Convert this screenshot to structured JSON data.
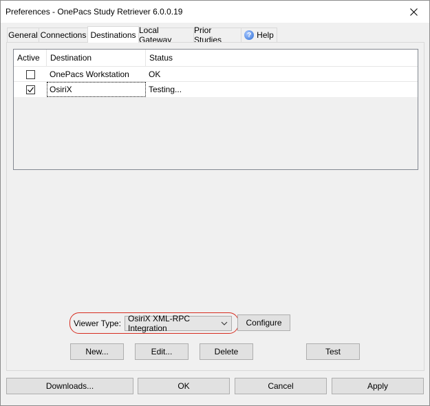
{
  "window": {
    "title": "Preferences - OnePacs Study Retriever 6.0.0.19",
    "close_symbol": "close-icon"
  },
  "tabs": [
    {
      "label": "General",
      "active": false
    },
    {
      "label": "Connections",
      "active": false
    },
    {
      "label": "Destinations",
      "active": true
    },
    {
      "label": "Local Gateway",
      "active": false
    },
    {
      "label": "Prior Studies",
      "active": false
    },
    {
      "label": "Help",
      "active": false,
      "icon": "help-icon"
    }
  ],
  "table": {
    "columns": [
      "Active",
      "Destination",
      "Status"
    ],
    "rows": [
      {
        "active": false,
        "destination": "OnePacs Workstation",
        "status": "OK"
      },
      {
        "active": true,
        "destination": "OsiriX",
        "status": "Testing..."
      }
    ]
  },
  "viewer": {
    "label": "Viewer Type:",
    "selected": "OsiriX XML-RPC Integration",
    "configure_label": "Configure"
  },
  "actions": {
    "new_label": "New...",
    "edit_label": "Edit...",
    "delete_label": "Delete",
    "test_label": "Test"
  },
  "footer": {
    "downloads_label": "Downloads...",
    "ok_label": "OK",
    "cancel_label": "Cancel",
    "apply_label": "Apply"
  },
  "colors": {
    "highlight_ring": "#d62b1e",
    "window_bg": "#f0f0f0"
  }
}
